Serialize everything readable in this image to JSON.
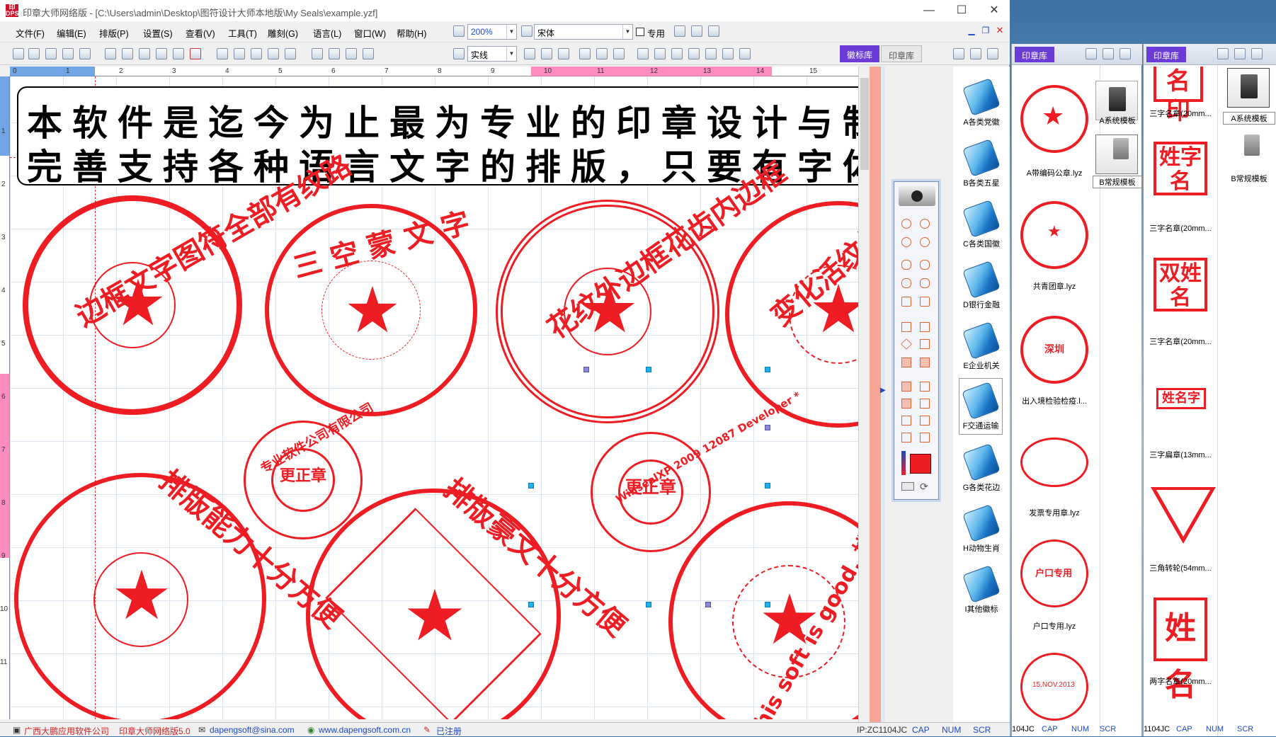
{
  "titlebar": {
    "title": "印章大师网络版 - [C:\\Users\\admin\\Desktop\\图符设计大师本地版\\My Seals\\example.yzf]",
    "logo_text": "印章\nDPS",
    "minimize": "—",
    "maximize": "☐",
    "close": "✕"
  },
  "menu": [
    "文件(F)",
    "编辑(E)",
    "排版(P)",
    "设置(S)",
    "查看(V)",
    "工具(T)",
    "雕刻(G)",
    "语言(L)",
    "窗口(W)",
    "帮助(H)"
  ],
  "toolbar": {
    "zoom": "200%",
    "font": "宋体",
    "dedicated_label": "专用",
    "line_style": "实线"
  },
  "main_tabs": [
    "徽标库",
    "印章库"
  ],
  "ruler_h": [
    "0",
    "1",
    "2",
    "3",
    "4",
    "5",
    "6",
    "7",
    "8",
    "9",
    "10",
    "11",
    "12",
    "13",
    "14",
    "15"
  ],
  "ruler_v": [
    "1",
    "2",
    "3",
    "4",
    "5",
    "6",
    "7",
    "8",
    "9",
    "10",
    "11"
  ],
  "canvas": {
    "banner_line1": "本软件是迄今为止最为专业的印章设计与制作",
    "banner_line2": "完善支持各种语言文字的排版，只要有字体",
    "seals": [
      {
        "ring": "边框文字图符全部有纹路",
        "center": "★"
      },
      {
        "ring": "三 空 蒙 文 字",
        "center": "★"
      },
      {
        "ring": "花纹外边框花齿内边框",
        "center": "★"
      },
      {
        "ring": "变化活纹外边框",
        "center": "★"
      },
      {
        "ring": "专业软件公司有限公司",
        "center": "更正章"
      },
      {
        "ring": "WinsealXP 2009 12087 Developer *",
        "center": "更正章"
      },
      {
        "ring": "排版能力十分方便",
        "center": "★"
      },
      {
        "ring": "排版豪文十分方便",
        "center": "★"
      },
      {
        "ring": "This soft is good. 排版",
        "center": "★"
      }
    ]
  },
  "logo_categories": [
    "A各类党徽",
    "B各类五星",
    "C各类国徽",
    "D银行金融",
    "E企业机关",
    "F交通运输",
    "G各类花边",
    "H动物生肖",
    "I其他徽标"
  ],
  "seal_panel": {
    "tab": "印章库",
    "items": [
      "A带编码公章.lyz",
      "共青团章.lyz",
      "出入境检验检疫.l...",
      "发票专用章.lyz",
      "户口专用.lyz"
    ],
    "seal_texts": [
      "深圳",
      "户口专用",
      "15.NOV.2013"
    ],
    "templates": [
      "A系统模板",
      "B常规模板"
    ]
  },
  "name_panel": {
    "tab": "印章库",
    "items": [
      "三字名章(20mm...",
      "三字名章(20mm...",
      "三字名章(20mm...",
      "三字扁章(13mm...",
      "三角转轮(54mm...",
      "两字名章(20mm..."
    ],
    "stamp_texts": [
      "名印",
      "姓字名",
      "双姓名",
      "姓名字",
      "姓名"
    ],
    "templates": [
      "A系统模板",
      "B常规模板"
    ]
  },
  "status": {
    "company": "广西大鹏应用软件公司",
    "product": "印章大师网络版5.0",
    "email": "dapengsoft@sina.com",
    "website": "www.dapengsoft.com.cn",
    "registered": "已注册",
    "ip": "IP:ZC1104JC",
    "ip_short": "104JC",
    "ip_short2": "1104JC",
    "cap": "CAP",
    "num": "NUM",
    "scr": "SCR"
  },
  "colors": {
    "seal_red": "#ee1d23",
    "tab_purple": "#6a3bd6",
    "link_blue": "#1a48c7"
  }
}
